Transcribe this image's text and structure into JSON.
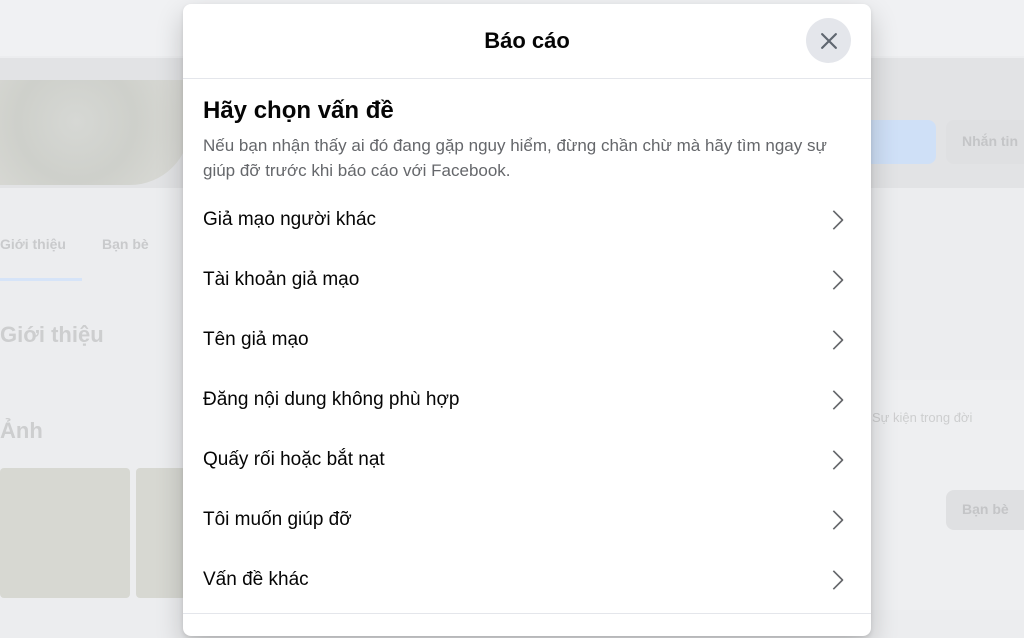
{
  "background": {
    "tabs": [
      "Giới thiệu",
      "Bạn bè"
    ],
    "about_heading": "Giới thiệu",
    "photos_heading": "Ảnh",
    "message_button": "Nhắn tin",
    "right_text": "Sự kiện trong đời",
    "right_button": "Bạn bè"
  },
  "modal": {
    "title": "Báo cáo",
    "close_icon": "close-icon",
    "section_title": "Hãy chọn vấn đề",
    "description": "Nếu bạn nhận thấy ai đó đang gặp nguy hiểm, đừng chần chừ mà hãy tìm ngay sự giúp đỡ trước khi báo cáo với Facebook.",
    "options": [
      {
        "label": "Giả mạo người khác"
      },
      {
        "label": "Tài khoản giả mạo"
      },
      {
        "label": "Tên giả mạo"
      },
      {
        "label": "Đăng nội dung không phù hợp"
      },
      {
        "label": "Quấy rối hoặc bắt nạt"
      },
      {
        "label": "Tôi muốn giúp đỡ"
      },
      {
        "label": "Vấn đề khác"
      }
    ],
    "chevron_icon": "chevron-right-icon"
  },
  "colors": {
    "overlay": "#ecedef",
    "modal_bg": "#ffffff",
    "text_primary": "#050505",
    "text_secondary": "#65676b",
    "divider": "#e4e6eb"
  }
}
